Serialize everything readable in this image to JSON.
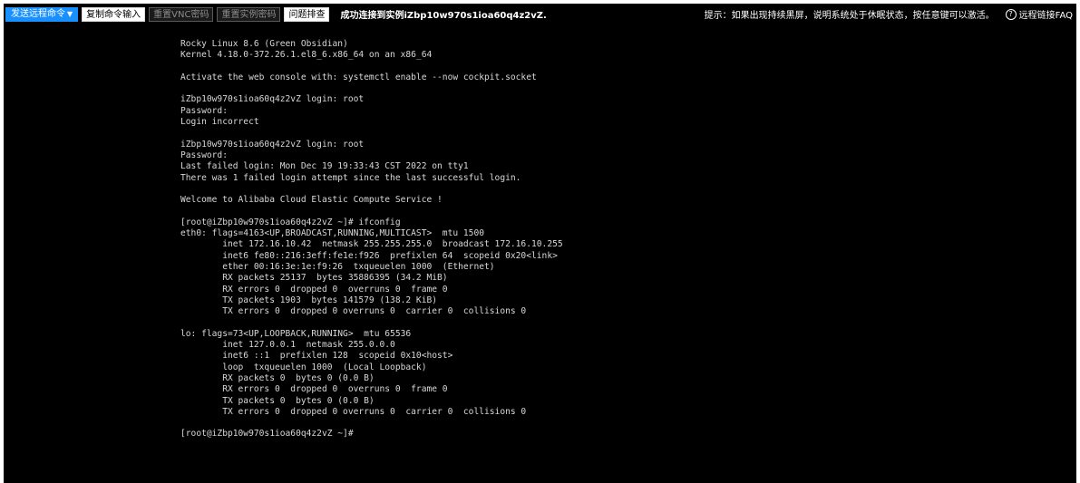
{
  "toolbar": {
    "send_command_label": "发送远程命令",
    "copy_input_label": "复制命令输入",
    "reset_vnc_password_label": "重置VNC密码",
    "reset_instance_password_label": "重置实例密码",
    "troubleshoot_label": "问题排查",
    "status_message": "成功连接到实例iZbp10w970s1ioa60q4z2vZ.",
    "hint": "提示：如果出现持续黑屏，说明系统处于休眠状态，按任意键可以激活。",
    "faq_label": "远程链接FAQ"
  },
  "terminal": {
    "lines": [
      "Rocky Linux 8.6 (Green Obsidian)",
      "Kernel 4.18.0-372.26.1.el8_6.x86_64 on an x86_64",
      "",
      "Activate the web console with: systemctl enable --now cockpit.socket",
      "",
      "iZbp10w970s1ioa60q4z2vZ login: root",
      "Password:",
      "Login incorrect",
      "",
      "iZbp10w970s1ioa60q4z2vZ login: root",
      "Password:",
      "Last failed login: Mon Dec 19 19:33:43 CST 2022 on tty1",
      "There was 1 failed login attempt since the last successful login.",
      "",
      "Welcome to Alibaba Cloud Elastic Compute Service !",
      "",
      "[root@iZbp10w970s1ioa60q4z2vZ ~]# ifconfig",
      "eth0: flags=4163<UP,BROADCAST,RUNNING,MULTICAST>  mtu 1500",
      "        inet 172.16.10.42  netmask 255.255.255.0  broadcast 172.16.10.255",
      "        inet6 fe80::216:3eff:fe1e:f926  prefixlen 64  scopeid 0x20<link>",
      "        ether 00:16:3e:1e:f9:26  txqueuelen 1000  (Ethernet)",
      "        RX packets 25137  bytes 35886395 (34.2 MiB)",
      "        RX errors 0  dropped 0  overruns 0  frame 0",
      "        TX packets 1903  bytes 141579 (138.2 KiB)",
      "        TX errors 0  dropped 0 overruns 0  carrier 0  collisions 0",
      "",
      "lo: flags=73<UP,LOOPBACK,RUNNING>  mtu 65536",
      "        inet 127.0.0.1  netmask 255.0.0.0",
      "        inet6 ::1  prefixlen 128  scopeid 0x10<host>",
      "        loop  txqueuelen 1000  (Local Loopback)",
      "        RX packets 0  bytes 0 (0.0 B)",
      "        RX errors 0  dropped 0  overruns 0  frame 0",
      "        TX packets 0  bytes 0 (0.0 B)",
      "        TX errors 0  dropped 0 overruns 0  carrier 0  collisions 0",
      "",
      "[root@iZbp10w970s1ioa60q4z2vZ ~]#"
    ]
  },
  "colors": {
    "primary_button": "#1890ff",
    "terminal_background": "#000000",
    "terminal_text": "#d8d8d8"
  }
}
